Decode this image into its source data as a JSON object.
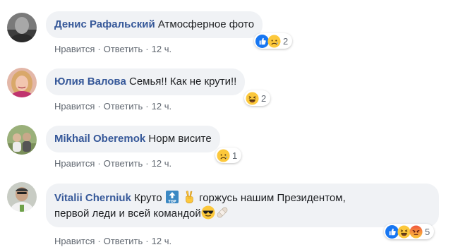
{
  "actions": {
    "like": "Нравится",
    "reply": "Ответить",
    "sep": "·"
  },
  "comments": [
    {
      "author": "Денис Рафальский",
      "text": "Атмосферное фото",
      "time": "12 ч.",
      "reaction_icons": [
        "like-icon",
        "sad-icon"
      ],
      "reaction_count": "2"
    },
    {
      "author": "Юлия Валова",
      "text": "Семья!! Как не крути!!",
      "time": "12 ч.",
      "reaction_icons": [
        "haha-icon"
      ],
      "reaction_count": "2"
    },
    {
      "author": "Mikhail Oberemok",
      "text": "Норм висите",
      "time": "12 ч.",
      "reaction_icons": [
        "sad-icon"
      ],
      "reaction_count": "1"
    },
    {
      "author": "Vitalii Cherniuk",
      "text_part1": "Круто",
      "text_part2": "горжусь нашим Президентом,",
      "text_line2": "первой леди и всей командой",
      "inline_icons": [
        "top-arrow-icon",
        "victory-hand-icon",
        "sunglasses-face-icon",
        "bandage-icon"
      ],
      "time": "12 ч.",
      "reaction_icons": [
        "like-icon",
        "haha-icon",
        "angry-icon"
      ],
      "reaction_count": "5"
    }
  ],
  "colors": {
    "author": "#365899",
    "bubble": "#f0f2f5",
    "meta": "#606770",
    "like": "#1877f2",
    "angry": "#f0563e",
    "emoji_yellow": "#fcc83c"
  }
}
